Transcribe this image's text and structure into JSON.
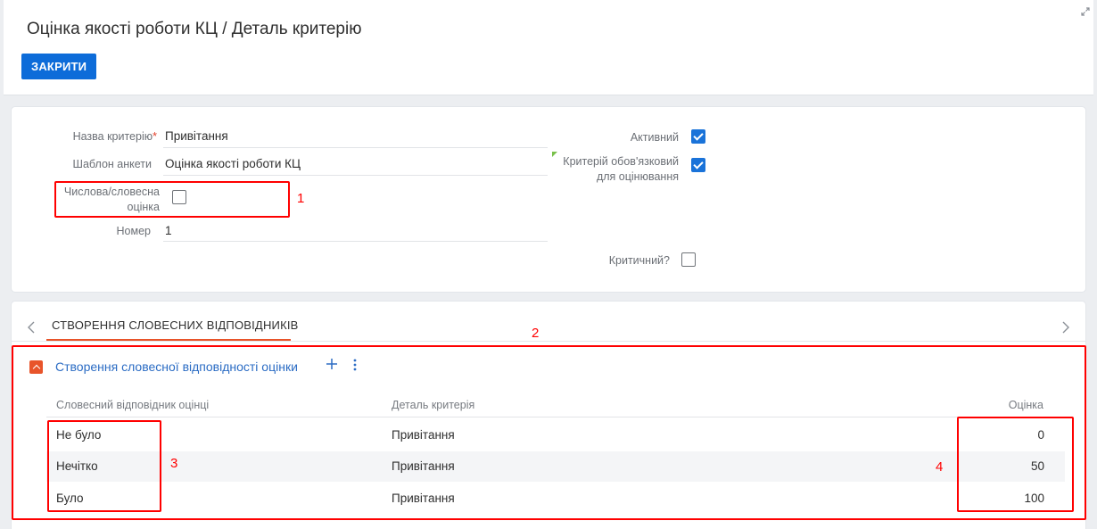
{
  "header": {
    "title": "Оцінка якості роботи КЦ / Деталь критерію",
    "close_label": "ЗАКРИТИ"
  },
  "form": {
    "name_label": "Назва критерію",
    "name_required_mark": "*",
    "name_value": "Привітання",
    "template_label": "Шаблон анкети",
    "template_value": "Оцінка якості роботи КЦ",
    "numeric_label_line1": "Числова/словесна",
    "numeric_label_line2": "оцінка",
    "numeric_checked": false,
    "number_label": "Номер",
    "number_value": "1",
    "active_label": "Активний",
    "active_checked": true,
    "mandatory_label_line1": "Критерій обов'язковий",
    "mandatory_label_line2": "для оцінювання",
    "mandatory_checked": true,
    "critical_label": "Критичний?",
    "critical_checked": false
  },
  "tabs": {
    "active_tab": "СТВОРЕННЯ СЛОВЕСНИХ ВІДПОВІДНИКІВ"
  },
  "detail": {
    "title": "Створення словесної відповідності оцінки",
    "columns": [
      "Словесний відповідник оцінці",
      "Деталь критерія",
      "Оцінка"
    ],
    "rows": [
      {
        "word": "Не було",
        "criterion": "Привітання",
        "score": "0"
      },
      {
        "word": "Нечітко",
        "criterion": "Привітання",
        "score": "50"
      },
      {
        "word": "Було",
        "criterion": "Привітання",
        "score": "100"
      }
    ]
  },
  "annotations": [
    "1",
    "2",
    "3",
    "4"
  ],
  "colors": {
    "primary": "#0d6cd9",
    "accent": "#e8542a",
    "link": "#2b6cc4",
    "annotation": "#ff0000"
  }
}
